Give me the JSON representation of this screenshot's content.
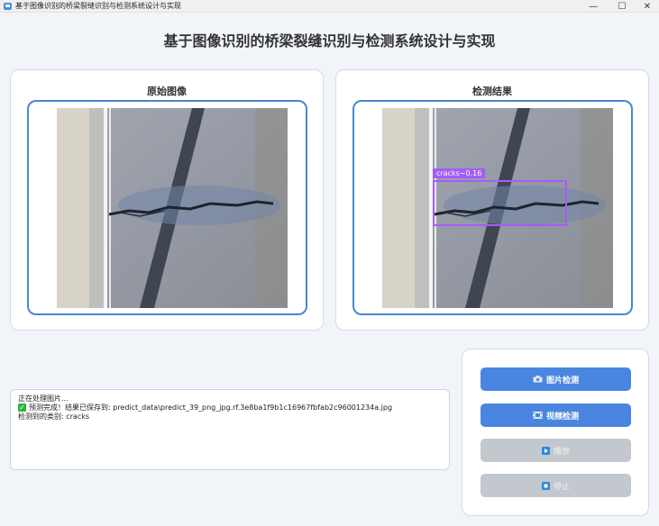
{
  "window": {
    "title": "基于图像识别的桥梁裂缝识别与检测系统设计与实现",
    "controls": {
      "minimize": "—",
      "maximize": "☐",
      "close": "✕"
    }
  },
  "app": {
    "heading": "基于图像识别的桥梁裂缝识别与检测系统设计与实现"
  },
  "panels": {
    "original": {
      "title": "原始图像"
    },
    "result": {
      "title": "检测结果",
      "detection": {
        "label": "cracks",
        "confidence": "0.16",
        "text": "cracks~0.16",
        "color": "#a45cff"
      }
    }
  },
  "log": {
    "lines": [
      "正在处理图片...",
      "预测完成！结果已保存到: predict_data\\predict_39_png_jpg.rf.3e8ba1f9b1c16967fbfab2c96001234a.jpg",
      "检测到的类别: cracks"
    ]
  },
  "buttons": {
    "image_detect": {
      "label": "图片检测",
      "icon": "camera-icon",
      "enabled": true
    },
    "video_detect": {
      "label": "视频检测",
      "icon": "film-icon",
      "enabled": true
    },
    "play": {
      "label": "播放",
      "icon": "play-icon",
      "enabled": false
    },
    "stop": {
      "label": "停止",
      "icon": "stop-icon",
      "enabled": false
    }
  },
  "colors": {
    "accent": "#4a86e0",
    "frame": "#4a86d1",
    "disabled": "#c3c8ce",
    "detection_box": "#a45cff",
    "success": "#2fb344"
  }
}
